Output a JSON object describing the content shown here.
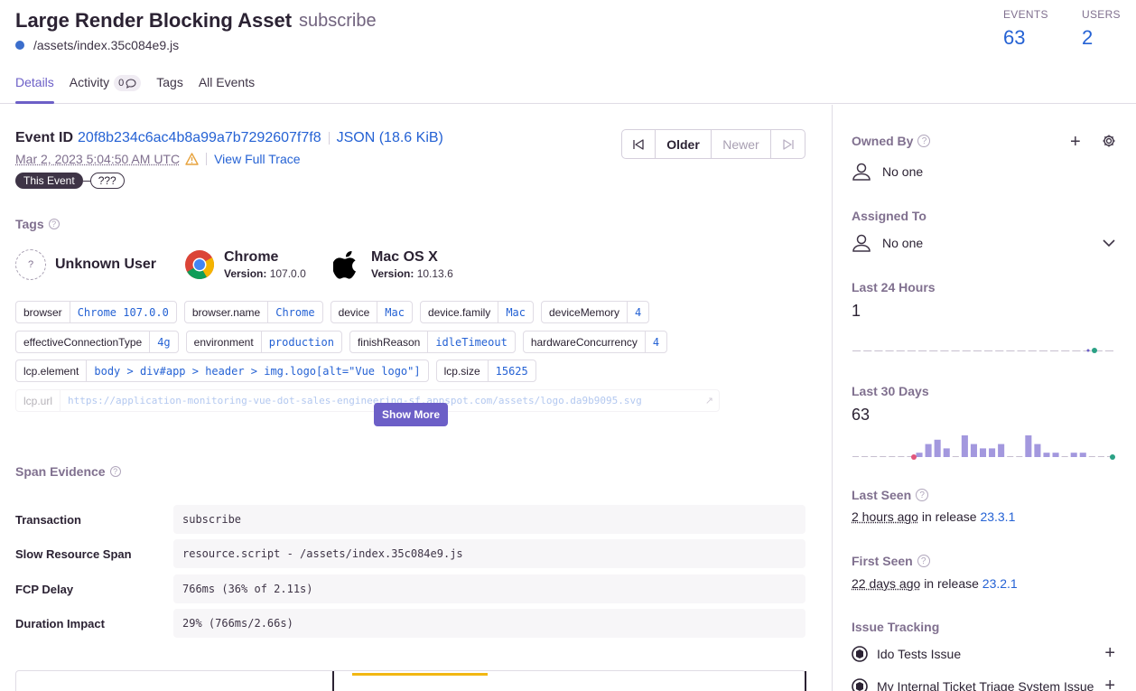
{
  "header": {
    "title": "Large Render Blocking Asset",
    "culprit": "subscribe",
    "subtitle": "/assets/index.35c084e9.js",
    "stats": [
      {
        "label": "EVENTS",
        "value": "63"
      },
      {
        "label": "USERS",
        "value": "2"
      }
    ],
    "tabs": [
      {
        "label": "Details"
      },
      {
        "label": "Activity",
        "count": "0"
      },
      {
        "label": "Tags"
      },
      {
        "label": "All Events"
      }
    ]
  },
  "event": {
    "id_label": "Event ID",
    "id": "20f8b234c6ac4b8a99a7b7292607f7f8",
    "json_link": "JSON (18.6 KiB)",
    "date": "Mar 2, 2023 5:04:50 AM UTC",
    "trace_link": "View Full Trace",
    "trail_current": "This Event",
    "trail_other": "???",
    "nav": {
      "older": "Older",
      "newer": "Newer"
    }
  },
  "tags": {
    "heading": "Tags",
    "contexts": {
      "user": {
        "title": "Unknown User"
      },
      "browser": {
        "title": "Chrome",
        "version_label": "Version:",
        "version": "107.0.0"
      },
      "os": {
        "title": "Mac OS X",
        "version_label": "Version:",
        "version": "10.13.6"
      }
    },
    "rows": [
      [
        {
          "k": "browser",
          "v": "Chrome 107.0.0"
        },
        {
          "k": "browser.name",
          "v": "Chrome"
        },
        {
          "k": "device",
          "v": "Mac"
        },
        {
          "k": "device.family",
          "v": "Mac"
        },
        {
          "k": "deviceMemory",
          "v": "4"
        }
      ],
      [
        {
          "k": "effectiveConnectionType",
          "v": "4g"
        },
        {
          "k": "environment",
          "v": "production"
        },
        {
          "k": "finishReason",
          "v": "idleTimeout"
        },
        {
          "k": "hardwareConcurrency",
          "v": "4"
        }
      ],
      [
        {
          "k": "lcp.element",
          "v": "body > div#app > header > img.logo[alt=\"Vue logo\"]"
        },
        {
          "k": "lcp.size",
          "v": "15625"
        }
      ],
      [
        {
          "k": "lcp.url",
          "v": "https://application-monitoring-vue-dot-sales-engineering-sf.appspot.com/assets/logo.da9b9095.svg"
        }
      ]
    ],
    "show_more": "Show More"
  },
  "span_evidence": {
    "heading": "Span Evidence",
    "rows": [
      {
        "k": "Transaction",
        "v": "subscribe"
      },
      {
        "k": "Slow Resource Span",
        "v": "resource.script - /assets/index.35c084e9.js"
      },
      {
        "k": "FCP Delay",
        "v": "766ms (36% of 2.11s)"
      },
      {
        "k": "Duration Impact",
        "v": "29% (766ms/2.66s)"
      }
    ]
  },
  "sidebar": {
    "owned_by": {
      "heading": "Owned By",
      "value": "No one"
    },
    "assigned_to": {
      "heading": "Assigned To",
      "value": "No one"
    },
    "last_24": {
      "heading": "Last 24 Hours",
      "value": "1"
    },
    "last_30": {
      "heading": "Last 30 Days",
      "value": "63",
      "bars": [
        0,
        0,
        0,
        0,
        0,
        0,
        0,
        1,
        3,
        4,
        2,
        0,
        5,
        3,
        2,
        2,
        3,
        0,
        0,
        5,
        3,
        1,
        1,
        0,
        1,
        1,
        0,
        0,
        0
      ]
    },
    "last_seen": {
      "heading": "Last Seen",
      "ago": "2 hours ago",
      "in_release": "in release",
      "release": "23.3.1"
    },
    "first_seen": {
      "heading": "First Seen",
      "ago": "22 days ago",
      "in_release": "in release",
      "release": "23.2.1"
    },
    "issue_tracking": {
      "heading": "Issue Tracking",
      "items": [
        {
          "label": "Ido Tests Issue"
        },
        {
          "label": "My Internal Ticket Triage System Issue"
        }
      ]
    }
  },
  "colors": {
    "accent": "#6c5fc7",
    "link": "#2562d4",
    "bar": "#a398de",
    "green": "#2ba185",
    "pink": "#e1567c"
  }
}
